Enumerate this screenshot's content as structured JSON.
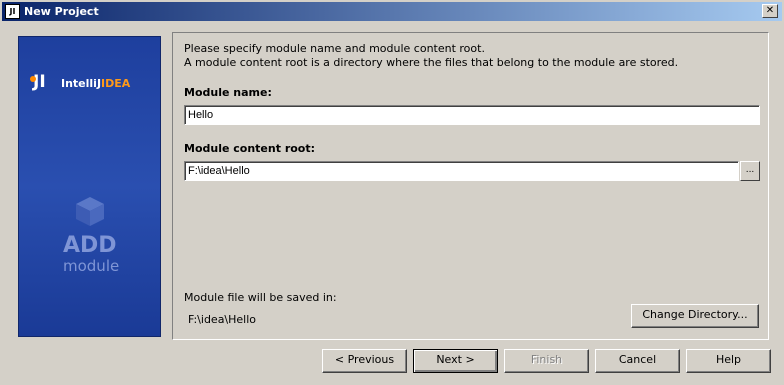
{
  "window": {
    "title": "New Project",
    "icon_label": "JI",
    "close_glyph": "✕"
  },
  "sidebar": {
    "logo_mark": "JI",
    "logo_brand": "IntelliJ",
    "logo_brand_accent": "IDEA",
    "big_word": "ADD",
    "sub_word": "module",
    "cube_icon": "cube-icon",
    "colors": {
      "panel": "#2a4fb0",
      "accent": "#ff9a1a",
      "faded_text": "#7f95d6"
    }
  },
  "content": {
    "description_line1": "Please specify module name and module content root.",
    "description_line2": "A module content root is a directory where the files that belong to the module are stored.",
    "module_name_label": "Module name:",
    "module_name_value": "Hello",
    "content_root_label": "Module content root:",
    "content_root_value": "F:\\idea\\Hello",
    "browse_label": "...",
    "saved_in_label": "Module file will be saved in:",
    "saved_in_value": "F:\\idea\\Hello",
    "change_directory_label": "Change Directory..."
  },
  "buttons": {
    "previous": "< Previous",
    "next": "Next >",
    "finish": "Finish",
    "cancel": "Cancel",
    "help": "Help"
  }
}
